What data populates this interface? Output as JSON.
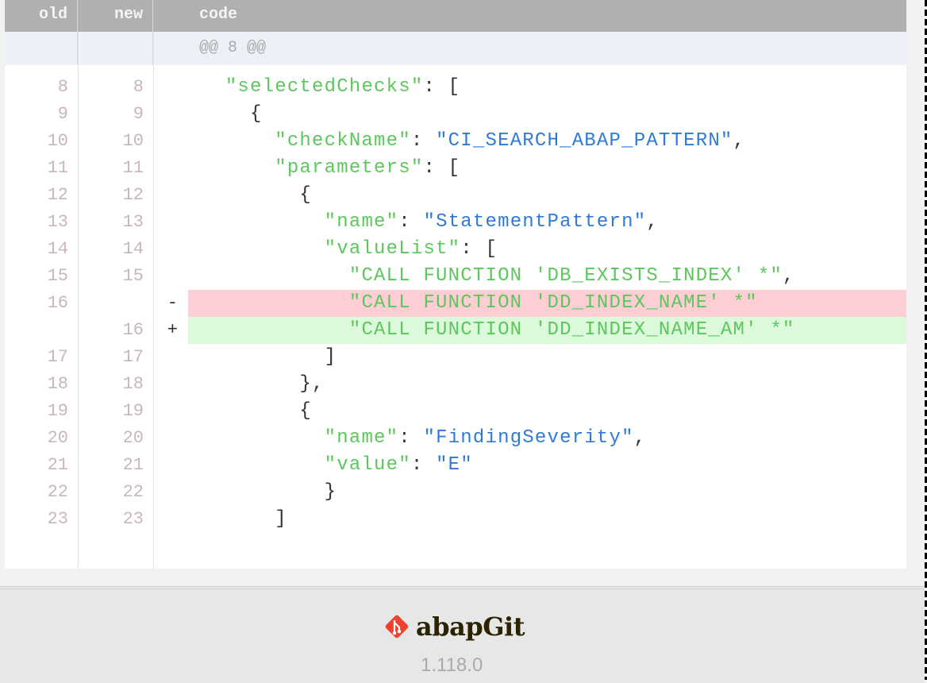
{
  "header": {
    "old": "old",
    "new": "new",
    "code": "code"
  },
  "hunk": "@@ 8 @@",
  "rows": [
    {
      "old": "8",
      "new": "8",
      "mk": "",
      "type": "",
      "ind": 3,
      "tk": [
        [
          "k",
          "\"selectedChecks\""
        ],
        [
          "p",
          ": ["
        ]
      ]
    },
    {
      "old": "9",
      "new": "9",
      "mk": "",
      "type": "",
      "ind": 5,
      "tk": [
        [
          "p",
          "{"
        ]
      ]
    },
    {
      "old": "10",
      "new": "10",
      "mk": "",
      "type": "",
      "ind": 7,
      "tk": [
        [
          "k",
          "\"checkName\""
        ],
        [
          "p",
          ": "
        ],
        [
          "s",
          "\"CI_SEARCH_ABAP_PATTERN\""
        ],
        [
          "p",
          ","
        ]
      ]
    },
    {
      "old": "11",
      "new": "11",
      "mk": "",
      "type": "",
      "ind": 7,
      "tk": [
        [
          "k",
          "\"parameters\""
        ],
        [
          "p",
          ": ["
        ]
      ]
    },
    {
      "old": "12",
      "new": "12",
      "mk": "",
      "type": "",
      "ind": 9,
      "tk": [
        [
          "p",
          "{"
        ]
      ]
    },
    {
      "old": "13",
      "new": "13",
      "mk": "",
      "type": "",
      "ind": 11,
      "tk": [
        [
          "k",
          "\"name\""
        ],
        [
          "p",
          ": "
        ],
        [
          "s",
          "\"StatementPattern\""
        ],
        [
          "p",
          ","
        ]
      ]
    },
    {
      "old": "14",
      "new": "14",
      "mk": "",
      "type": "",
      "ind": 11,
      "tk": [
        [
          "k",
          "\"valueList\""
        ],
        [
          "p",
          ": ["
        ]
      ]
    },
    {
      "old": "15",
      "new": "15",
      "mk": "",
      "type": "",
      "ind": 13,
      "tk": [
        [
          "g",
          "\"CALL FUNCTION 'DB_EXISTS_INDEX' *\""
        ],
        [
          "p",
          ","
        ]
      ]
    },
    {
      "old": "16",
      "new": "",
      "mk": "-",
      "type": "del",
      "ind": 13,
      "tk": [
        [
          "g",
          "\"CALL FUNCTION 'DD_INDEX_NAME' *\""
        ]
      ]
    },
    {
      "old": "",
      "new": "16",
      "mk": "+",
      "type": "add",
      "ind": 13,
      "tk": [
        [
          "g",
          "\"CALL FUNCTION 'DD_INDEX_NAME_AM' *\""
        ]
      ]
    },
    {
      "old": "17",
      "new": "17",
      "mk": "",
      "type": "",
      "ind": 11,
      "tk": [
        [
          "p",
          "]"
        ]
      ]
    },
    {
      "old": "18",
      "new": "18",
      "mk": "",
      "type": "",
      "ind": 9,
      "tk": [
        [
          "p",
          "},"
        ]
      ]
    },
    {
      "old": "19",
      "new": "19",
      "mk": "",
      "type": "",
      "ind": 9,
      "tk": [
        [
          "p",
          "{"
        ]
      ]
    },
    {
      "old": "20",
      "new": "20",
      "mk": "",
      "type": "",
      "ind": 11,
      "tk": [
        [
          "k",
          "\"name\""
        ],
        [
          "p",
          ": "
        ],
        [
          "s",
          "\"FindingSeverity\""
        ],
        [
          "p",
          ","
        ]
      ]
    },
    {
      "old": "21",
      "new": "21",
      "mk": "",
      "type": "",
      "ind": 11,
      "tk": [
        [
          "k",
          "\"value\""
        ],
        [
          "p",
          ": "
        ],
        [
          "s",
          "\"E\""
        ]
      ]
    },
    {
      "old": "22",
      "new": "22",
      "mk": "",
      "type": "",
      "ind": 11,
      "tk": [
        [
          "p",
          "}"
        ]
      ]
    },
    {
      "old": "23",
      "new": "23",
      "mk": "",
      "type": "",
      "ind": 7,
      "tk": [
        [
          "p",
          "]"
        ]
      ]
    }
  ],
  "footer": {
    "brand": "abapGit",
    "version": "1.118.0"
  },
  "colors": {
    "header": "#b0b0b0",
    "deleted": "#ffcdd4",
    "added": "#dcf9dc",
    "key": "#5cc85c",
    "string": "#2f7ad6",
    "logo": "#f0412f"
  }
}
